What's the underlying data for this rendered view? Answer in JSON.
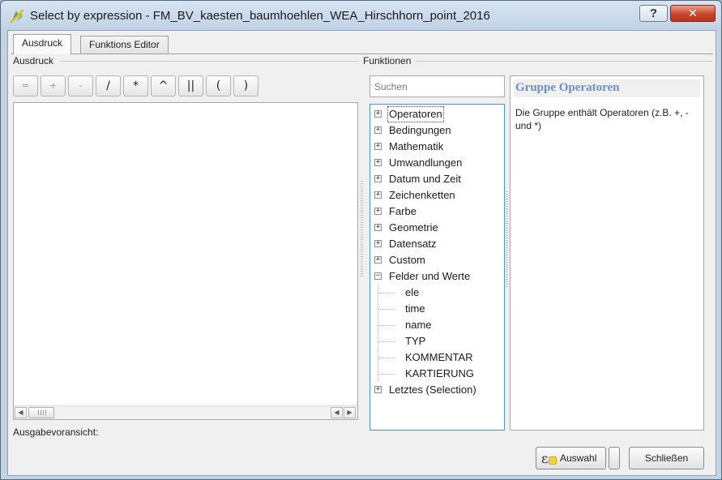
{
  "window": {
    "title": "Select by expression - FM_BV_kaesten_baumhoehlen_WEA_Hirschhorn_point_2016",
    "help_glyph": "?",
    "close_glyph": "✕"
  },
  "tabs": [
    {
      "label": "Ausdruck",
      "active": true
    },
    {
      "label": "Funktions Editor",
      "active": false
    }
  ],
  "expression_group": {
    "label": "Ausdruck",
    "operators": [
      "=",
      "+",
      "-",
      "/",
      "*",
      "^",
      "||",
      "(",
      ")"
    ],
    "preview_label": "Ausgabevoransicht:"
  },
  "functions_group": {
    "label": "Funktionen",
    "search_placeholder": "Suchen",
    "tree": [
      {
        "label": "Operatoren",
        "expanded": false,
        "selected": true
      },
      {
        "label": "Bedingungen",
        "expanded": false
      },
      {
        "label": "Mathematik",
        "expanded": false
      },
      {
        "label": "Umwandlungen",
        "expanded": false
      },
      {
        "label": "Datum und Zeit",
        "expanded": false
      },
      {
        "label": "Zeichenketten",
        "expanded": false
      },
      {
        "label": "Farbe",
        "expanded": false
      },
      {
        "label": "Geometrie",
        "expanded": false
      },
      {
        "label": "Datensatz",
        "expanded": false
      },
      {
        "label": "Custom",
        "expanded": false
      },
      {
        "label": "Felder und Werte",
        "expanded": true,
        "children": [
          "ele",
          "time",
          "name",
          "TYP",
          "KOMMENTAR",
          "KARTIERUNG"
        ]
      },
      {
        "label": "Letztes (Selection)",
        "expanded": false
      }
    ]
  },
  "help_panel": {
    "title": "Gruppe Operatoren",
    "text": "Die Gruppe enthält Operatoren (z.B. +, - und *)"
  },
  "buttons": {
    "select_label": "Auswahl",
    "close_label": "Schließen"
  },
  "colors": {
    "title_bar": "#c6d6e9",
    "help_title": "#6b8fc7",
    "tree_border": "#4f8fd6"
  }
}
